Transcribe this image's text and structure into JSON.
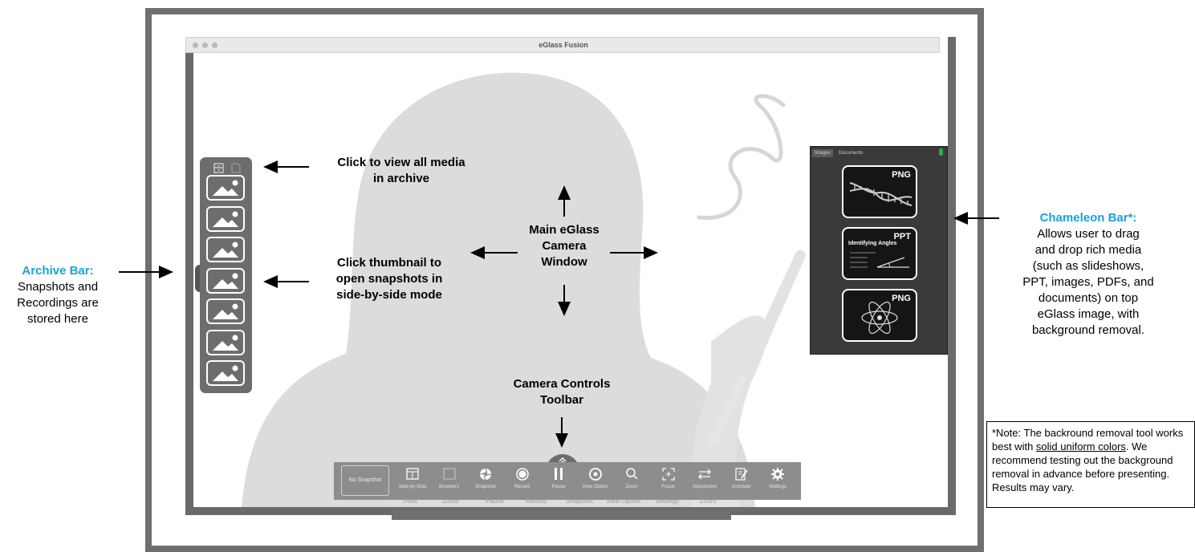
{
  "window": {
    "title": "eGlass Fusion"
  },
  "archive_bar": {
    "icons": [
      "archive-box-icon",
      "document-icon"
    ],
    "thumbnail_count": 7
  },
  "chameleon_bar": {
    "tabs": [
      "Images",
      "Documents"
    ],
    "cards": [
      {
        "label": "PNG",
        "icon": "dna-icon"
      },
      {
        "label": "PPT",
        "icon": "slide-icon",
        "title": "Identifying Angles"
      },
      {
        "label": "PNG",
        "icon": "atom-icon"
      }
    ]
  },
  "toolbar": {
    "no_snapshot": "No Snapshot",
    "buttons": [
      {
        "label": "Side-by-Side",
        "icon": "side-by-side-icon"
      },
      {
        "label": "Browsers",
        "icon": "browser-icon"
      },
      {
        "label": "Snapshot",
        "icon": "aperture-icon"
      },
      {
        "label": "Record",
        "icon": "record-icon"
      },
      {
        "label": "Pause",
        "icon": "pause-icon"
      },
      {
        "label": "View Option",
        "icon": "eye-icon"
      },
      {
        "label": "Zoom",
        "icon": "magnifier-icon"
      },
      {
        "label": "Focus",
        "icon": "focus-icon"
      },
      {
        "label": "Adjustment",
        "icon": "adjust-icon"
      },
      {
        "label": "Annotate",
        "icon": "annotate-icon"
      },
      {
        "label": "Settings",
        "icon": "gear-icon"
      }
    ],
    "ghost_labels": [
      "Files",
      "Zoom",
      "Pause",
      "Record",
      "Snapshot",
      "View Option",
      "Settings",
      "Zoom"
    ]
  },
  "annotations": {
    "archive_media": [
      "Click to view all media",
      "in archive"
    ],
    "thumbnail": [
      "Click thumbnail to",
      "open snapshots in",
      "side-by-side mode"
    ],
    "main_window": [
      "Main eGlass",
      "Camera",
      "Window"
    ],
    "camera_toolbar": [
      "Camera Controls",
      "Toolbar"
    ],
    "archive_bar_title": "Archive Bar:",
    "archive_bar_desc": [
      "Snapshots and",
      "Recordings are",
      "stored here"
    ],
    "chameleon_title": "Chameleon Bar*:",
    "chameleon_desc": [
      "Allows user to drag",
      "and drop rich media",
      "(such as slideshows,",
      "PPT, images, PDFs, and",
      "documents) on top",
      "eGlass image, with",
      "background removal."
    ]
  },
  "note": {
    "pre": "*Note: The backround removal tool works best with ",
    "underline": "solid uniform colors",
    "post": ". We recommend testing out the background removal in advance before presenting. Results may vary."
  }
}
